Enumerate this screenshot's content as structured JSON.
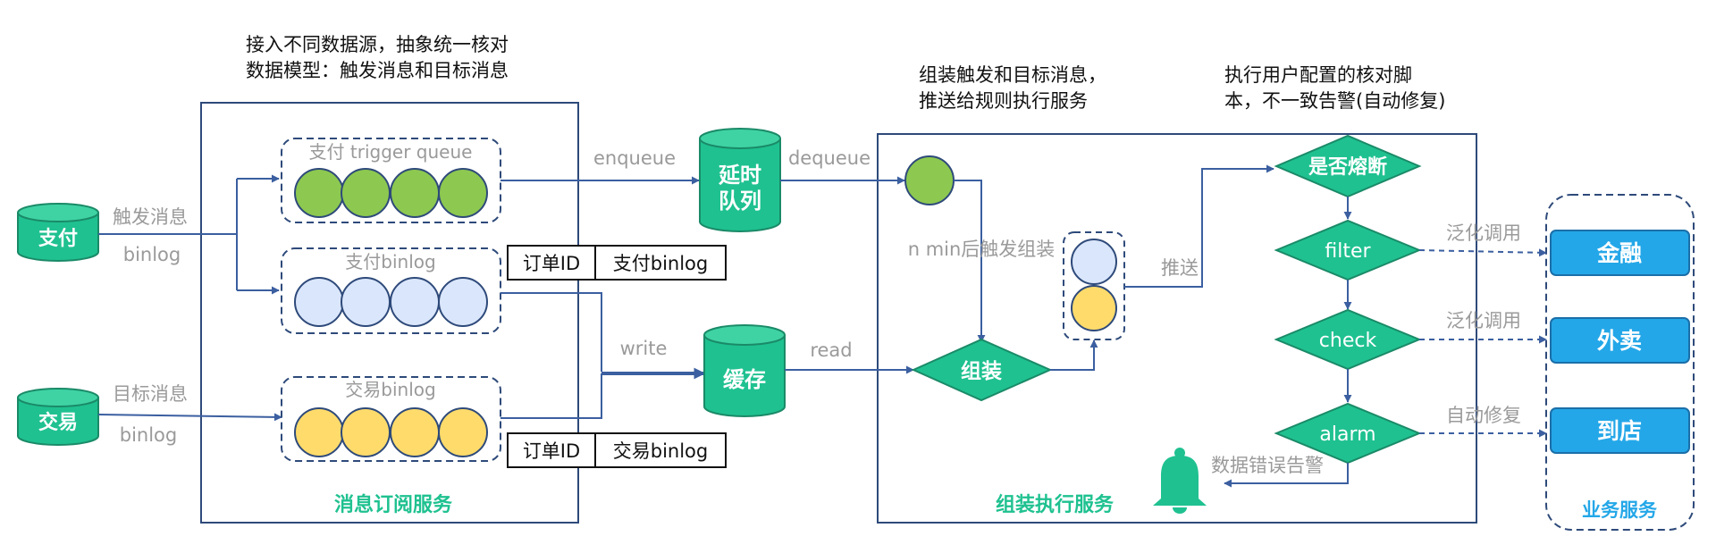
{
  "annotations": {
    "subscribe_desc_line1": "接入不同数据源，抽象统一核对",
    "subscribe_desc_line2": "数据模型：触发消息和目标消息",
    "assemble_desc_line1": "组装触发和目标消息，",
    "assemble_desc_line2": "推送给规则执行服务",
    "execute_desc_line1": "执行用户配置的核对脚",
    "execute_desc_line2": "本，不一致告警(自动修复)"
  },
  "sources": {
    "pay": {
      "label": "支付",
      "msg_label": "触发消息",
      "binlog_label": "binlog"
    },
    "trade": {
      "label": "交易",
      "msg_label": "目标消息",
      "binlog_label": "binlog"
    }
  },
  "queues": {
    "trigger": {
      "label": "支付 trigger queue"
    },
    "pay_binlog": {
      "label": "支付binlog"
    },
    "trade_binlog": {
      "label": "交易binlog"
    }
  },
  "tables": {
    "pay": {
      "key": "订单ID",
      "value": "支付binlog"
    },
    "trade": {
      "key": "订单ID",
      "value": "交易binlog"
    }
  },
  "storage": {
    "delay_queue_line1": "延时",
    "delay_queue_line2": "队列",
    "cache": "缓存"
  },
  "edges": {
    "enqueue": "enqueue",
    "dequeue": "dequeue",
    "write": "write",
    "read": "read",
    "n_min": "n min后触发组装",
    "push": "推送",
    "generic_call_1": "泛化调用",
    "generic_call_2": "泛化调用",
    "auto_fix": "自动修复",
    "data_error_alarm": "数据错误告警"
  },
  "nodes": {
    "assemble": "组装",
    "circuit_breaker": "是否熔断",
    "filter": "filter",
    "check": "check",
    "alarm": "alarm"
  },
  "business": {
    "finance": "金融",
    "takeout": "外卖",
    "store": "到店"
  },
  "services": {
    "subscribe": "消息订阅服务",
    "assemble": "组装执行服务",
    "business": "业务服务"
  },
  "colors": {
    "teal": "#1fc190",
    "green_dot": "#8dc850",
    "blue_dot": "#dae6fb",
    "yellow_dot": "#fedb6b",
    "business_blue": "#24a7e8",
    "frame_navy": "#2e4a7a",
    "arrow": "#3b5fa0",
    "label_gray": "#9a9a9a"
  }
}
